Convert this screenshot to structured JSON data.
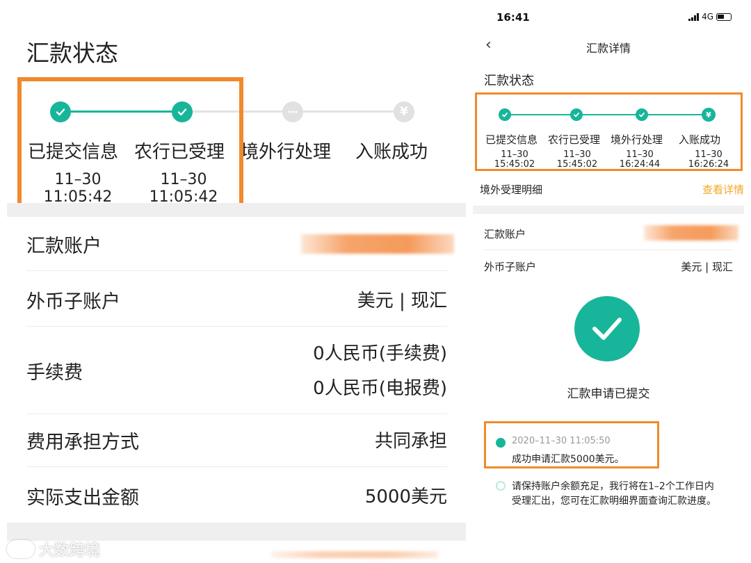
{
  "left": {
    "title": "汇款状态",
    "steps": [
      {
        "label": "已提交信息",
        "date": "11–30",
        "time": "11:05:42",
        "status": "done"
      },
      {
        "label": "农行已受理",
        "date": "11–30",
        "time": "11:05:42",
        "status": "done"
      },
      {
        "label": "境外行处理",
        "status": "pending"
      },
      {
        "label": "入账成功",
        "status": "pending",
        "icon": "¥"
      }
    ],
    "rows": {
      "account": {
        "label": "汇款账户"
      },
      "sub_account": {
        "label": "外币子账户",
        "value": "美元 | 现汇"
      },
      "fee": {
        "label": "手续费",
        "value1": "0人民币(手续费)",
        "value2": "0人民币(电报费)"
      },
      "fee_bearer": {
        "label": "费用承担方式",
        "value": "共同承担"
      },
      "actual_amount": {
        "label": "实际支出金额",
        "value": "5000美元"
      }
    },
    "watermark": "大数跨境"
  },
  "right": {
    "status_bar": {
      "time": "16:41",
      "network": "4G"
    },
    "nav": {
      "back_icon": "‹",
      "title": "汇款详情"
    },
    "title": "汇款状态",
    "steps": [
      {
        "label": "已提交信息",
        "date": "11–30",
        "time": "15:45:02"
      },
      {
        "label": "农行已受理",
        "date": "11–30",
        "time": "15:45:02"
      },
      {
        "label": "境外行处理",
        "date": "11–30",
        "time": "16:24:44"
      },
      {
        "label": "入账成功",
        "date": "11–30",
        "time": "16:26:24",
        "icon": "¥"
      }
    ],
    "overseas": {
      "label": "境外受理明细",
      "link": "查看详情"
    },
    "rows": {
      "account": {
        "label": "汇款账户"
      },
      "sub_account": {
        "label": "外币子账户",
        "value": "美元 | 现汇"
      }
    },
    "submitted": "汇款申请已提交",
    "timeline": {
      "time": "2020–11–30 11:05:50",
      "text1": "成功申请汇款5000美元。",
      "text2": "请保持账户余额充足，我行将在1–2个工作日内受理汇出，您可在汇款明细界面查询汇款进度。"
    }
  },
  "colors": {
    "accent": "#17b59a",
    "highlight": "#f08a2c",
    "link": "#f5a623"
  }
}
